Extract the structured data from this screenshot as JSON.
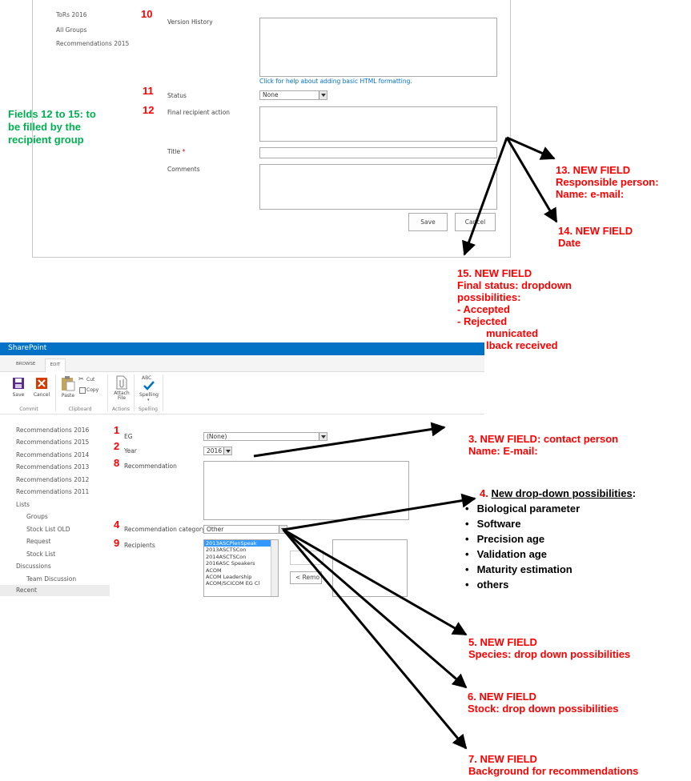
{
  "top_form": {
    "nav_items": [
      "ToRs 2016",
      "All Groups",
      "Recommendations 2015"
    ],
    "version_history_label": "Version History",
    "help_link": "Click for help about adding basic HTML formatting.",
    "status_label": "Status",
    "status_value": "None",
    "final_recipient_label": "Final recipient action",
    "title_label": "Title",
    "required_star": "*",
    "comments_label": "Comments",
    "save_label": "Save",
    "cancel_label": "Cancel"
  },
  "top_annotations": {
    "n10": "10",
    "n11": "11",
    "n12": "12",
    "fields_note": [
      "Fields 12 to 15: to",
      "be filled by the",
      "recipient group"
    ],
    "f13": [
      "13. NEW FIELD",
      "Responsible person:",
      "Name:     e-mail:"
    ],
    "f14": [
      "14. NEW FIELD",
      "Date"
    ],
    "f15": [
      "15. NEW FIELD",
      "Final status: dropdown",
      "possibilities:",
      "-   Accepted",
      "-   Rejected",
      "municated",
      "lback received"
    ]
  },
  "sharepoint": {
    "brand": "SharePoint",
    "tabs": [
      "BROWSE",
      "EDIT"
    ],
    "ribbon": {
      "save": "Save",
      "cancel": "Cancel",
      "paste": "Paste",
      "cut": "Cut",
      "copy": "Copy",
      "attach": "Attach File",
      "spelling": "Spelling",
      "abc": "ABC",
      "groups": [
        "Commit",
        "Clipboard",
        "Actions",
        "Spelling"
      ]
    },
    "nav": [
      "Recommendations 2016",
      "Recommendations 2015",
      "Recommendations 2014",
      "Recommendations 2013",
      "Recommendations 2012",
      "Recommendations 2011",
      "Lists",
      "Groups",
      "Stock List OLD",
      "Request",
      "Stock List",
      "Discussions",
      "Team Discussion",
      "Recent"
    ],
    "form": {
      "eg_label": "EG",
      "eg_value": "(None)",
      "year_label": "Year",
      "year_value": "2016",
      "recommendation_label": "Recommendation",
      "category_label": "Recommendation category",
      "category_value": "Other",
      "recipients_label": "Recipients",
      "recipients": [
        "2013ASCPlenSpeak",
        "2013ASCTSCon",
        "2014ASCTSCon",
        "2016ASC Speakers",
        "ACOM",
        "ACOM Leadership",
        "ACOM/SCICOM EG Cl"
      ],
      "remove_label": "< Remo"
    }
  },
  "bottom_annotations": {
    "n1": "1",
    "n2": "2",
    "n8": "8",
    "n4": "4",
    "n9": "9",
    "f3": [
      "3. NEW FIELD: contact person",
      "Name:            E-mail:"
    ],
    "f4_num": "4.",
    "f4_title": "New drop-down possibilities",
    "f4_colon": ":",
    "f4_items": [
      "Biological parameter",
      "Software",
      "Precision age",
      "Validation age",
      "Maturity estimation",
      "others"
    ],
    "bullet": "•",
    "f5": [
      "5. NEW FIELD",
      "Species: drop down possibilities"
    ],
    "f6": [
      "6. NEW FIELD",
      "Stock: drop down possibilities"
    ],
    "f7": [
      "7. NEW FIELD",
      "Background for recommendations"
    ]
  },
  "colors": {
    "annotation_red": "#ff0000",
    "note_green": "#00b050",
    "sp_blue": "#0072c6",
    "link_blue": "#0072c6"
  }
}
